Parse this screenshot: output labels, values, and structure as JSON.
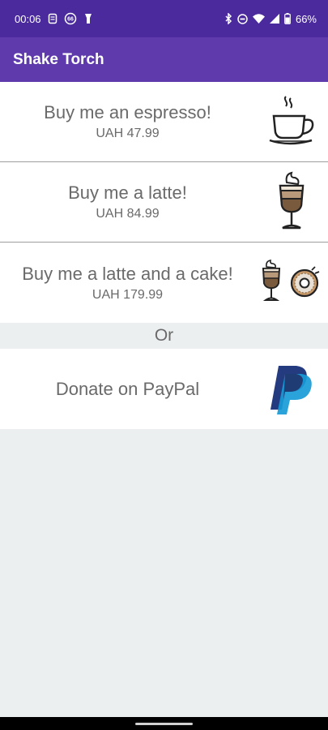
{
  "status_bar": {
    "time": "00:06",
    "battery_text": "66%",
    "notif_badge": "66"
  },
  "app_bar": {
    "title": "Shake Torch"
  },
  "items": [
    {
      "title": "Buy me an espresso!",
      "price": "UAH 47.99",
      "icon": "espresso-cup-icon"
    },
    {
      "title": "Buy me a latte!",
      "price": "UAH 84.99",
      "icon": "latte-glass-icon"
    },
    {
      "title": "Buy me a latte and a cake!",
      "price": "UAH 179.99",
      "icon": "latte-and-donut-icon"
    }
  ],
  "or_label": "Or",
  "paypal": {
    "label": "Donate on PayPal",
    "icon": "paypal-icon"
  },
  "colors": {
    "status_bar": "#4a2a9c",
    "app_bar": "#5e3aad",
    "background": "#eceff0"
  }
}
